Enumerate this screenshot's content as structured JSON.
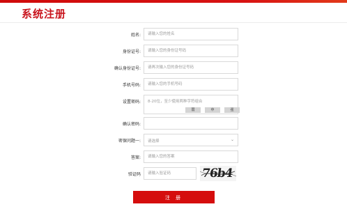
{
  "header": {
    "title": "系统注册"
  },
  "form": {
    "name": {
      "label": "姓名:",
      "placeholder": "请输入您的姓名"
    },
    "id_number": {
      "label": "身份证号:",
      "placeholder": "请输入您的身份证号码"
    },
    "confirm_id": {
      "label": "确认身份证号:",
      "placeholder": "请再次输入您的身份证号码"
    },
    "phone": {
      "label": "手机号码:",
      "placeholder": "请输入您的手机号码"
    },
    "password": {
      "label": "设置密码:",
      "placeholder": "8-20位，至少使用两种字符组合",
      "strength": [
        "弱",
        "中",
        "强"
      ]
    },
    "confirm_password": {
      "label": "确认密码:",
      "placeholder": ""
    },
    "security_question": {
      "label": "密保问题一:",
      "selected": "请选择"
    },
    "answer": {
      "label": "答案:",
      "placeholder": "请输入您的答案"
    },
    "captcha": {
      "label": "验证码",
      "placeholder": "请输入验证码",
      "image_text": "76b4"
    },
    "submit_label": "注 册"
  },
  "colors": {
    "brand_red": "#c9151e",
    "button_red": "#d50d0d"
  }
}
